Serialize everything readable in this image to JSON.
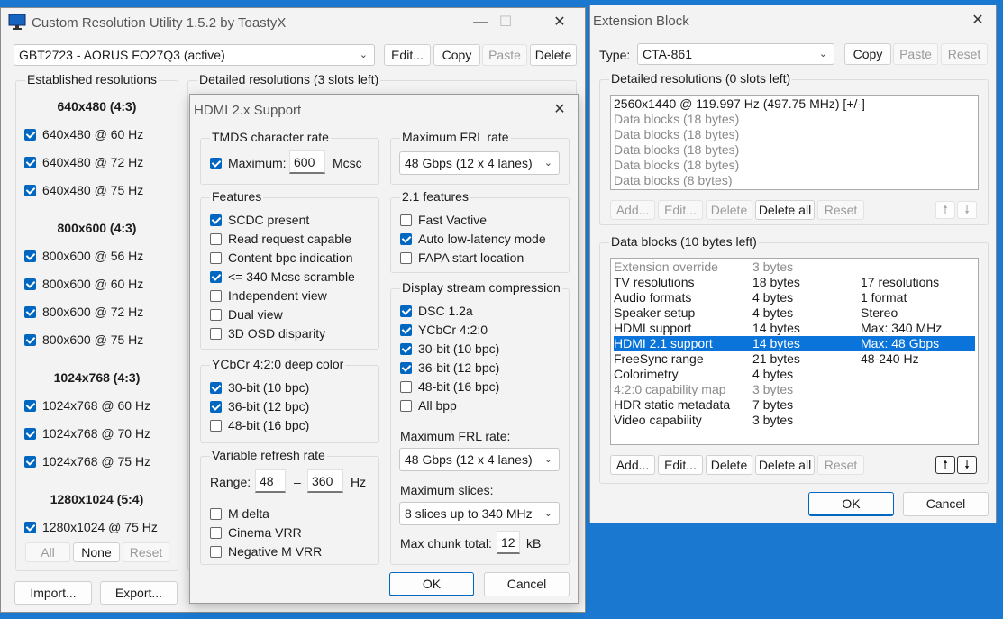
{
  "main": {
    "title": "Custom Resolution Utility 1.5.2 by ToastyX",
    "monitor": "GBT2723 - AORUS FO27Q3 (active)",
    "buttons": {
      "edit": "Edit...",
      "copy": "Copy",
      "paste": "Paste",
      "delete": "Delete"
    },
    "established_title": "Established resolutions",
    "groups": [
      {
        "header": "640x480 (4:3)",
        "items": [
          "640x480 @ 60 Hz",
          "640x480 @ 72 Hz",
          "640x480 @ 75 Hz"
        ]
      },
      {
        "header": "800x600 (4:3)",
        "items": [
          "800x600 @ 56 Hz",
          "800x600 @ 60 Hz",
          "800x600 @ 72 Hz",
          "800x600 @ 75 Hz"
        ]
      },
      {
        "header": "1024x768 (4:3)",
        "items": [
          "1024x768 @ 60 Hz",
          "1024x768 @ 70 Hz",
          "1024x768 @ 75 Hz"
        ]
      },
      {
        "header": "1280x1024 (5:4)",
        "items": [
          "1280x1024 @ 75 Hz"
        ]
      }
    ],
    "sel_buttons": {
      "all": "All",
      "none": "None",
      "reset": "Reset"
    },
    "detailed_title": "Detailed resolutions (3 slots left)",
    "import": "Import...",
    "export": "Export..."
  },
  "hdmi": {
    "title": "HDMI 2.x Support",
    "tmds": {
      "title": "TMDS character rate",
      "max_label": "Maximum:",
      "value": "600",
      "unit": "Mcsc"
    },
    "features": {
      "title": "Features",
      "items": [
        {
          "label": "SCDC present",
          "checked": true
        },
        {
          "label": "Read request capable",
          "checked": false
        },
        {
          "label": "Content bpc indication",
          "checked": false
        },
        {
          "label": "<= 340 Mcsc scramble",
          "checked": true
        },
        {
          "label": "Independent view",
          "checked": false
        },
        {
          "label": "Dual view",
          "checked": false
        },
        {
          "label": "3D OSD disparity",
          "checked": false
        }
      ]
    },
    "ycbcr": {
      "title": "YCbCr 4:2:0 deep color",
      "items": [
        {
          "label": "30-bit (10 bpc)",
          "checked": true
        },
        {
          "label": "36-bit (12 bpc)",
          "checked": true
        },
        {
          "label": "48-bit (16 bpc)",
          "checked": false
        }
      ]
    },
    "vrr": {
      "title": "Variable refresh rate",
      "range_label": "Range:",
      "min": "48",
      "dash": "–",
      "max": "360",
      "unit": "Hz",
      "items": [
        {
          "label": "M delta",
          "checked": false
        },
        {
          "label": "Cinema VRR",
          "checked": false
        },
        {
          "label": "Negative M VRR",
          "checked": false
        }
      ]
    },
    "frl": {
      "title": "Maximum FRL rate",
      "value": "48 Gbps (12 x 4 lanes)"
    },
    "f21": {
      "title": "2.1 features",
      "items": [
        {
          "label": "Fast Vactive",
          "checked": false
        },
        {
          "label": "Auto low-latency mode",
          "checked": true
        },
        {
          "label": "FAPA start location",
          "checked": false
        }
      ]
    },
    "dsc": {
      "title": "Display stream compression",
      "items": [
        {
          "label": "DSC 1.2a",
          "checked": true
        },
        {
          "label": "YCbCr 4:2:0",
          "checked": true
        },
        {
          "label": "30-bit (10 bpc)",
          "checked": true
        },
        {
          "label": "36-bit (12 bpc)",
          "checked": true
        },
        {
          "label": "48-bit (16 bpc)",
          "checked": false
        },
        {
          "label": "All bpp",
          "checked": false
        }
      ],
      "frl_label": "Maximum FRL rate:",
      "frl_value": "48 Gbps (12 x 4 lanes)",
      "slices_label": "Maximum slices:",
      "slices_value": "8 slices up to 340 MHz",
      "chunk_label": "Max chunk total:",
      "chunk_value": "12",
      "chunk_unit": "kB"
    },
    "ok": "OK",
    "cancel": "Cancel"
  },
  "ext": {
    "title": "Extension Block",
    "type_label": "Type:",
    "type_value": "CTA-861",
    "buttons": {
      "copy": "Copy",
      "paste": "Paste",
      "reset": "Reset"
    },
    "detailed_title": "Detailed resolutions (0 slots left)",
    "detailed_items": [
      {
        "text": "2560x1440 @ 119.997 Hz (497.75 MHz) [+/-]",
        "grey": false
      },
      {
        "text": "Data blocks (18 bytes)",
        "grey": true
      },
      {
        "text": "Data blocks (18 bytes)",
        "grey": true
      },
      {
        "text": "Data blocks (18 bytes)",
        "grey": true
      },
      {
        "text": "Data blocks (18 bytes)",
        "grey": true
      },
      {
        "text": "Data blocks (8 bytes)",
        "grey": true
      }
    ],
    "detailed_buttons": {
      "add": "Add...",
      "edit": "Edit...",
      "delete": "Delete",
      "delete_all": "Delete all",
      "reset": "Reset"
    },
    "data_title": "Data blocks (10 bytes left)",
    "data_items": [
      {
        "name": "Extension override",
        "size": "3 bytes",
        "info": "",
        "grey": true
      },
      {
        "name": "TV resolutions",
        "size": "18 bytes",
        "info": "17 resolutions",
        "grey": false
      },
      {
        "name": "Audio formats",
        "size": "4 bytes",
        "info": "1 format",
        "grey": false
      },
      {
        "name": "Speaker setup",
        "size": "4 bytes",
        "info": "Stereo",
        "grey": false
      },
      {
        "name": "HDMI support",
        "size": "14 bytes",
        "info": "Max: 340 MHz",
        "grey": false
      },
      {
        "name": "HDMI 2.1 support",
        "size": "14 bytes",
        "info": "Max: 48 Gbps",
        "grey": false,
        "selected": true
      },
      {
        "name": "FreeSync range",
        "size": "21 bytes",
        "info": "48-240 Hz",
        "grey": false
      },
      {
        "name": "Colorimetry",
        "size": "4 bytes",
        "info": "",
        "grey": false
      },
      {
        "name": "4:2:0 capability map",
        "size": "3 bytes",
        "info": "",
        "grey": true
      },
      {
        "name": "HDR static metadata",
        "size": "7 bytes",
        "info": "",
        "grey": false
      },
      {
        "name": "Video capability",
        "size": "3 bytes",
        "info": "",
        "grey": false
      }
    ],
    "data_buttons": {
      "add": "Add...",
      "edit": "Edit...",
      "delete": "Delete",
      "delete_all": "Delete all",
      "reset": "Reset"
    },
    "ok": "OK",
    "cancel": "Cancel"
  },
  "colors": {
    "accent": "#0067c0",
    "desktop": "#1a78d0",
    "selection": "#0a74da"
  }
}
